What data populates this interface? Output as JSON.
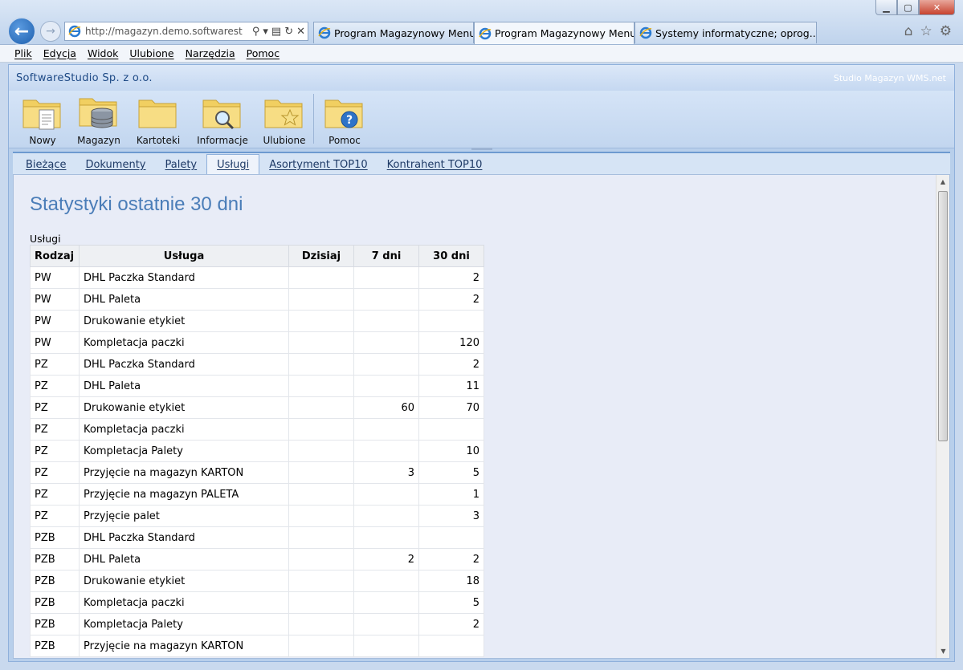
{
  "browser": {
    "address": "http://magazyn.demo.softwarestu...",
    "tabs": [
      {
        "label": "Program Magazynowy Menu",
        "active": false
      },
      {
        "label": "Program Magazynowy Menu",
        "active": true
      },
      {
        "label": "Systemy informatyczne; oprog...",
        "active": false
      }
    ],
    "close_glyph": "×",
    "menu": [
      "Plik",
      "Edycja",
      "Widok",
      "Ulubione",
      "Narzędzia",
      "Pomoc"
    ]
  },
  "app": {
    "company": "SoftwareStudio Sp. z o.o.",
    "product": "Studio Magazyn WMS.net",
    "ribbon": [
      {
        "label": "Nowy",
        "icon": "new-document-folder-icon"
      },
      {
        "label": "Magazyn",
        "icon": "database-folder-icon"
      },
      {
        "label": "Kartoteki",
        "icon": "folder-icon"
      },
      {
        "label": "Informacje",
        "icon": "search-folder-icon"
      },
      {
        "label": "Ulubione",
        "icon": "star-folder-icon"
      },
      {
        "label": "Pomoc",
        "icon": "help-folder-icon"
      }
    ],
    "tabs": [
      "Bieżące",
      "Dokumenty",
      "Palety",
      "Usługi",
      "Asortyment TOP10",
      "Kontrahent TOP10"
    ],
    "active_tab": "Usługi"
  },
  "content": {
    "title": "Statystyki ostatnie 30 dni",
    "section": "Usługi",
    "table": {
      "headers": [
        "Rodzaj",
        "Usługa",
        "Dzisiaj",
        "7 dni",
        "30 dni"
      ],
      "rows": [
        [
          "PW",
          "DHL Paczka Standard",
          "",
          "",
          "2"
        ],
        [
          "PW",
          "DHL Paleta",
          "",
          "",
          "2"
        ],
        [
          "PW",
          "Drukowanie etykiet",
          "",
          "",
          ""
        ],
        [
          "PW",
          "Kompletacja paczki",
          "",
          "",
          "120"
        ],
        [
          "PZ",
          "DHL Paczka Standard",
          "",
          "",
          "2"
        ],
        [
          "PZ",
          "DHL Paleta",
          "",
          "",
          "11"
        ],
        [
          "PZ",
          "Drukowanie etykiet",
          "",
          "60",
          "70"
        ],
        [
          "PZ",
          "Kompletacja paczki",
          "",
          "",
          ""
        ],
        [
          "PZ",
          "Kompletacja Palety",
          "",
          "",
          "10"
        ],
        [
          "PZ",
          "Przyjęcie na magazyn KARTON",
          "",
          "3",
          "5"
        ],
        [
          "PZ",
          "Przyjęcie na magazyn PALETA",
          "",
          "",
          "1"
        ],
        [
          "PZ",
          "Przyjęcie palet",
          "",
          "",
          "3"
        ],
        [
          "PZB",
          "DHL Paczka Standard",
          "",
          "",
          ""
        ],
        [
          "PZB",
          "DHL Paleta",
          "",
          "2",
          "2"
        ],
        [
          "PZB",
          "Drukowanie etykiet",
          "",
          "",
          "18"
        ],
        [
          "PZB",
          "Kompletacja paczki",
          "",
          "",
          "5"
        ],
        [
          "PZB",
          "Kompletacja Palety",
          "",
          "",
          "2"
        ],
        [
          "PZB",
          "Przyjęcie na magazyn KARTON",
          "",
          "",
          ""
        ]
      ]
    }
  }
}
